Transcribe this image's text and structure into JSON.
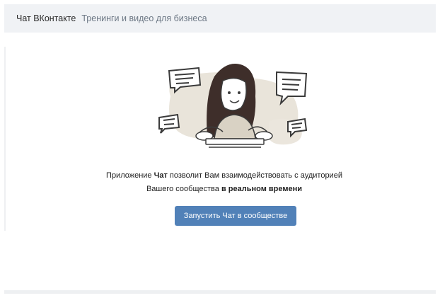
{
  "header": {
    "title": "Чат ВКонтакте",
    "subtitle": "Тренинги и видео для бизнеса"
  },
  "message": {
    "line1_prefix": "Приложение ",
    "line1_bold": "Чат",
    "line1_suffix": " позволит Вам взаимодействовать с аудиторией",
    "line2_prefix": "Вашего сообщества ",
    "line2_bold": "в реальном времени"
  },
  "cta": {
    "label": "Запустить Чат в сообществе"
  },
  "colors": {
    "button": "#5181b8",
    "header_bg": "#f0f2f5",
    "illustration_blob": "#e9e4da"
  }
}
